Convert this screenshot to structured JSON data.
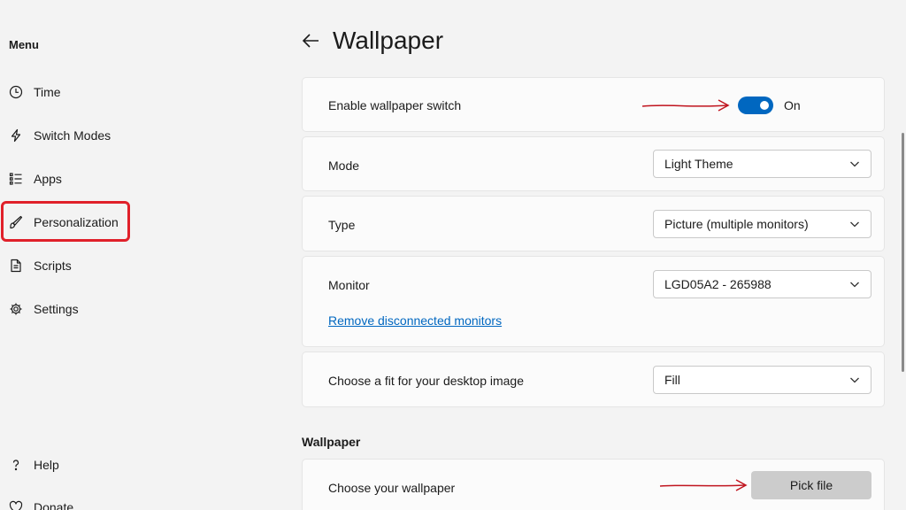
{
  "sidebar": {
    "menu_title": "Menu",
    "items": [
      {
        "label": "Time",
        "icon": "clock-icon"
      },
      {
        "label": "Switch Modes",
        "icon": "lightning-icon"
      },
      {
        "label": "Apps",
        "icon": "list-icon"
      },
      {
        "label": "Personalization",
        "icon": "brush-icon",
        "highlighted": true
      },
      {
        "label": "Scripts",
        "icon": "document-icon"
      },
      {
        "label": "Settings",
        "icon": "gear-icon"
      }
    ],
    "footer_items": [
      {
        "label": "Help",
        "icon": "question-icon"
      },
      {
        "label": "Donate",
        "icon": "heart-icon"
      }
    ]
  },
  "header": {
    "title": "Wallpaper"
  },
  "settings": {
    "enable_switch": {
      "label": "Enable wallpaper switch",
      "state": "On"
    },
    "mode": {
      "label": "Mode",
      "value": "Light Theme"
    },
    "type": {
      "label": "Type",
      "value": "Picture (multiple monitors)"
    },
    "monitor": {
      "label": "Monitor",
      "value": "LGD05A2 - 265988",
      "link": "Remove disconnected monitors"
    },
    "fit": {
      "label": "Choose a fit for your desktop image",
      "value": "Fill"
    }
  },
  "wallpaper_section": {
    "heading": "Wallpaper",
    "choose_label": "Choose your wallpaper",
    "button_label": "Pick file"
  },
  "colors": {
    "accent": "#0067c0",
    "annotation": "#c0141e",
    "highlight": "#e0202a"
  }
}
